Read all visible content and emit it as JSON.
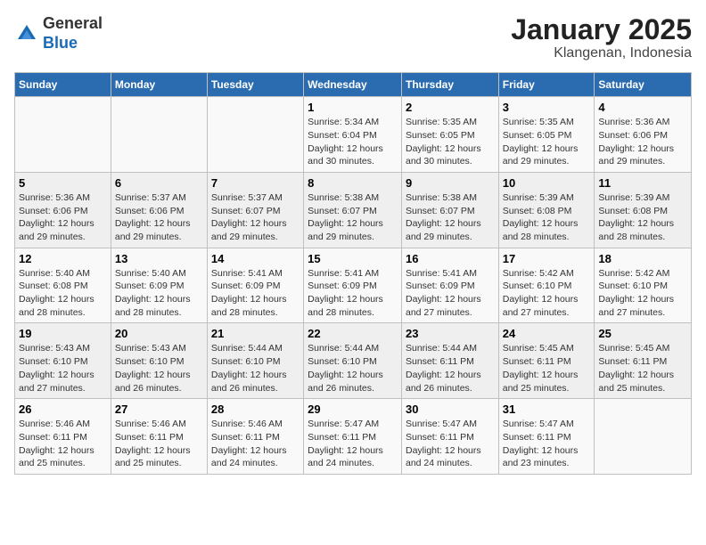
{
  "header": {
    "logo_line1": "General",
    "logo_line2": "Blue",
    "title": "January 2025",
    "subtitle": "Klangenan, Indonesia"
  },
  "weekdays": [
    "Sunday",
    "Monday",
    "Tuesday",
    "Wednesday",
    "Thursday",
    "Friday",
    "Saturday"
  ],
  "weeks": [
    [
      {
        "day": "",
        "text": ""
      },
      {
        "day": "",
        "text": ""
      },
      {
        "day": "",
        "text": ""
      },
      {
        "day": "1",
        "text": "Sunrise: 5:34 AM\nSunset: 6:04 PM\nDaylight: 12 hours and 30 minutes."
      },
      {
        "day": "2",
        "text": "Sunrise: 5:35 AM\nSunset: 6:05 PM\nDaylight: 12 hours and 30 minutes."
      },
      {
        "day": "3",
        "text": "Sunrise: 5:35 AM\nSunset: 6:05 PM\nDaylight: 12 hours and 29 minutes."
      },
      {
        "day": "4",
        "text": "Sunrise: 5:36 AM\nSunset: 6:06 PM\nDaylight: 12 hours and 29 minutes."
      }
    ],
    [
      {
        "day": "5",
        "text": "Sunrise: 5:36 AM\nSunset: 6:06 PM\nDaylight: 12 hours and 29 minutes."
      },
      {
        "day": "6",
        "text": "Sunrise: 5:37 AM\nSunset: 6:06 PM\nDaylight: 12 hours and 29 minutes."
      },
      {
        "day": "7",
        "text": "Sunrise: 5:37 AM\nSunset: 6:07 PM\nDaylight: 12 hours and 29 minutes."
      },
      {
        "day": "8",
        "text": "Sunrise: 5:38 AM\nSunset: 6:07 PM\nDaylight: 12 hours and 29 minutes."
      },
      {
        "day": "9",
        "text": "Sunrise: 5:38 AM\nSunset: 6:07 PM\nDaylight: 12 hours and 29 minutes."
      },
      {
        "day": "10",
        "text": "Sunrise: 5:39 AM\nSunset: 6:08 PM\nDaylight: 12 hours and 28 minutes."
      },
      {
        "day": "11",
        "text": "Sunrise: 5:39 AM\nSunset: 6:08 PM\nDaylight: 12 hours and 28 minutes."
      }
    ],
    [
      {
        "day": "12",
        "text": "Sunrise: 5:40 AM\nSunset: 6:08 PM\nDaylight: 12 hours and 28 minutes."
      },
      {
        "day": "13",
        "text": "Sunrise: 5:40 AM\nSunset: 6:09 PM\nDaylight: 12 hours and 28 minutes."
      },
      {
        "day": "14",
        "text": "Sunrise: 5:41 AM\nSunset: 6:09 PM\nDaylight: 12 hours and 28 minutes."
      },
      {
        "day": "15",
        "text": "Sunrise: 5:41 AM\nSunset: 6:09 PM\nDaylight: 12 hours and 28 minutes."
      },
      {
        "day": "16",
        "text": "Sunrise: 5:41 AM\nSunset: 6:09 PM\nDaylight: 12 hours and 27 minutes."
      },
      {
        "day": "17",
        "text": "Sunrise: 5:42 AM\nSunset: 6:10 PM\nDaylight: 12 hours and 27 minutes."
      },
      {
        "day": "18",
        "text": "Sunrise: 5:42 AM\nSunset: 6:10 PM\nDaylight: 12 hours and 27 minutes."
      }
    ],
    [
      {
        "day": "19",
        "text": "Sunrise: 5:43 AM\nSunset: 6:10 PM\nDaylight: 12 hours and 27 minutes."
      },
      {
        "day": "20",
        "text": "Sunrise: 5:43 AM\nSunset: 6:10 PM\nDaylight: 12 hours and 26 minutes."
      },
      {
        "day": "21",
        "text": "Sunrise: 5:44 AM\nSunset: 6:10 PM\nDaylight: 12 hours and 26 minutes."
      },
      {
        "day": "22",
        "text": "Sunrise: 5:44 AM\nSunset: 6:10 PM\nDaylight: 12 hours and 26 minutes."
      },
      {
        "day": "23",
        "text": "Sunrise: 5:44 AM\nSunset: 6:11 PM\nDaylight: 12 hours and 26 minutes."
      },
      {
        "day": "24",
        "text": "Sunrise: 5:45 AM\nSunset: 6:11 PM\nDaylight: 12 hours and 25 minutes."
      },
      {
        "day": "25",
        "text": "Sunrise: 5:45 AM\nSunset: 6:11 PM\nDaylight: 12 hours and 25 minutes."
      }
    ],
    [
      {
        "day": "26",
        "text": "Sunrise: 5:46 AM\nSunset: 6:11 PM\nDaylight: 12 hours and 25 minutes."
      },
      {
        "day": "27",
        "text": "Sunrise: 5:46 AM\nSunset: 6:11 PM\nDaylight: 12 hours and 25 minutes."
      },
      {
        "day": "28",
        "text": "Sunrise: 5:46 AM\nSunset: 6:11 PM\nDaylight: 12 hours and 24 minutes."
      },
      {
        "day": "29",
        "text": "Sunrise: 5:47 AM\nSunset: 6:11 PM\nDaylight: 12 hours and 24 minutes."
      },
      {
        "day": "30",
        "text": "Sunrise: 5:47 AM\nSunset: 6:11 PM\nDaylight: 12 hours and 24 minutes."
      },
      {
        "day": "31",
        "text": "Sunrise: 5:47 AM\nSunset: 6:11 PM\nDaylight: 12 hours and 23 minutes."
      },
      {
        "day": "",
        "text": ""
      }
    ]
  ]
}
